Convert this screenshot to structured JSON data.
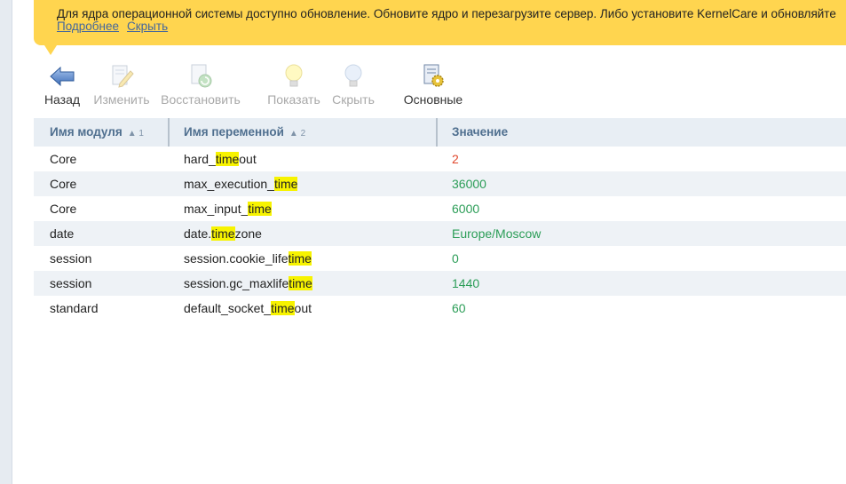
{
  "notice": {
    "text": "Для ядра операционной системы доступно обновление. Обновите ядро и перезагрузите сервер. Либо установите KernelCare и обновляйте",
    "links": [
      "Подробнее",
      "Скрыть"
    ]
  },
  "toolbar": [
    {
      "id": "back",
      "label": "Назад",
      "enabled": true,
      "icon": "back-arrow-icon"
    },
    {
      "id": "edit",
      "label": "Изменить",
      "enabled": false,
      "icon": "edit-pencil-icon"
    },
    {
      "id": "restore",
      "label": "Восстановить",
      "enabled": false,
      "icon": "restore-icon"
    },
    {
      "id": "show",
      "label": "Показать",
      "enabled": false,
      "icon": "bulb-on-icon"
    },
    {
      "id": "hide",
      "label": "Скрыть",
      "enabled": false,
      "icon": "bulb-off-icon"
    },
    {
      "id": "main",
      "label": "Основные",
      "enabled": true,
      "icon": "settings-gear-icon"
    }
  ],
  "table": {
    "columns": [
      {
        "label": "Имя модуля",
        "sort": "▲ 1"
      },
      {
        "label": "Имя переменной",
        "sort": "▲ 2"
      },
      {
        "label": "Значение",
        "sort": ""
      }
    ],
    "highlight": "time",
    "rows": [
      {
        "module": "Core",
        "variable": "hard_timeout",
        "value": "2",
        "status": "red"
      },
      {
        "module": "Core",
        "variable": "max_execution_time",
        "value": "36000",
        "status": "green"
      },
      {
        "module": "Core",
        "variable": "max_input_time",
        "value": "6000",
        "status": "green"
      },
      {
        "module": "date",
        "variable": "date.timezone",
        "value": "Europe/Moscow",
        "status": "green"
      },
      {
        "module": "session",
        "variable": "session.cookie_lifetime",
        "value": "0",
        "status": "green"
      },
      {
        "module": "session",
        "variable": "session.gc_maxlifetime",
        "value": "1440",
        "status": "green"
      },
      {
        "module": "standard",
        "variable": "default_socket_timeout",
        "value": "60",
        "status": "green"
      }
    ]
  },
  "colors": {
    "notice_bg": "#ffd54f",
    "link": "#44679c",
    "header_bg": "#e8eef4",
    "header_text": "#4f6f8f",
    "row_alt": "#eef2f6",
    "value_red": "#e0472c",
    "value_green": "#2b9d57",
    "highlight": "#f7f300"
  }
}
